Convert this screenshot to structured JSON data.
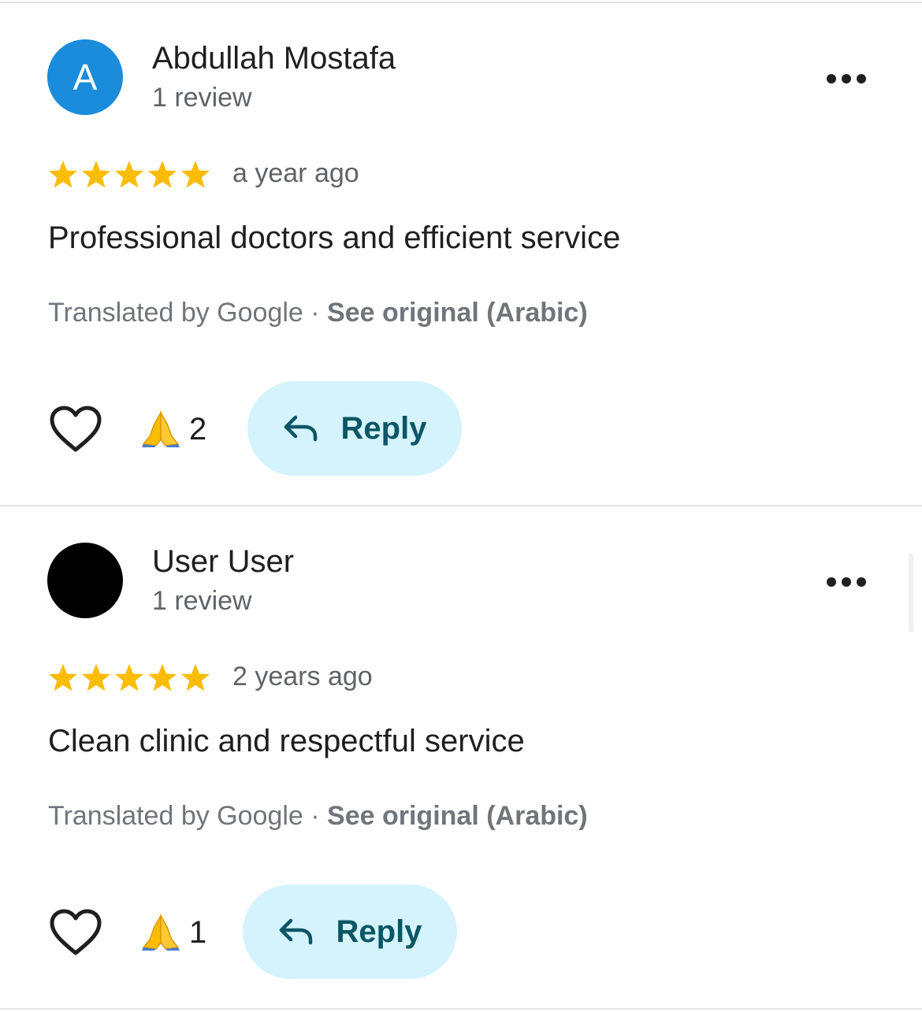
{
  "reviews": [
    {
      "avatar_letter": "A",
      "avatar_color": "#1a8cdb",
      "name": "Abdullah Mostafa",
      "review_count": "1 review",
      "rating": 5,
      "time": "a year ago",
      "text": "Professional doctors and efficient service",
      "translated_by": "Translated by Google · ",
      "see_original": "See original (Arabic)",
      "reaction_emoji": "🙏",
      "reaction_count": "2",
      "reply_label": "Reply"
    },
    {
      "avatar_letter": "",
      "avatar_color": "#000000",
      "name": "User User",
      "review_count": "1 review",
      "rating": 5,
      "time": "2 years ago",
      "text": "Clean clinic and respectful service",
      "translated_by": "Translated by Google · ",
      "see_original": "See original (Arabic)",
      "reaction_emoji": "🙏",
      "reaction_count": "1",
      "reply_label": "Reply"
    }
  ],
  "colors": {
    "star": "#fbbc04",
    "reply_bg": "#d4f3fc",
    "reply_text": "#0b5665"
  }
}
